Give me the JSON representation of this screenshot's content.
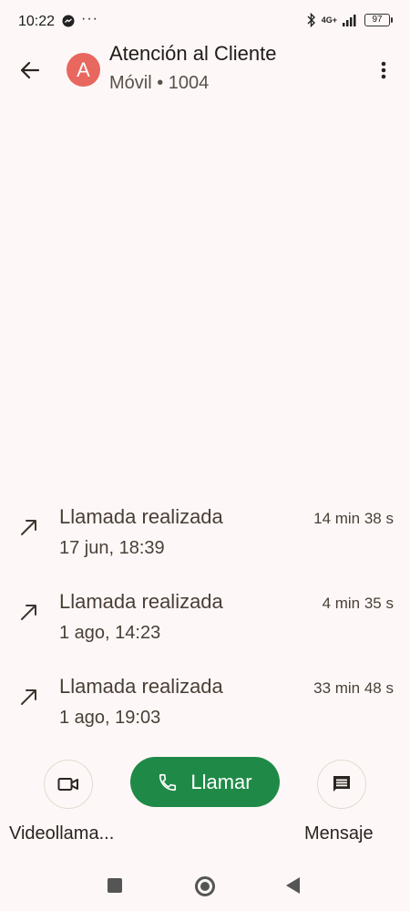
{
  "status_bar": {
    "time": "10:22",
    "dots": "···",
    "network": "4G+",
    "battery": "97"
  },
  "header": {
    "avatar_letter": "A",
    "avatar_color": "#e8675e",
    "contact_name": "Atención al Cliente",
    "contact_sub": "Móvil • 1004"
  },
  "calls": [
    {
      "type": "Llamada realizada",
      "date": "17 jun, 18:39",
      "duration": "14 min 38 s"
    },
    {
      "type": "Llamada realizada",
      "date": "1 ago, 14:23",
      "duration": "4 min 35 s"
    },
    {
      "type": "Llamada realizada",
      "date": "1 ago, 19:03",
      "duration": "33 min 48 s"
    }
  ],
  "actions": {
    "video_label": "Videollama...",
    "call_label": "Llamar",
    "message_label": "Mensaje"
  },
  "colors": {
    "call_button": "#1f8a47",
    "background": "#fdf8f7"
  }
}
